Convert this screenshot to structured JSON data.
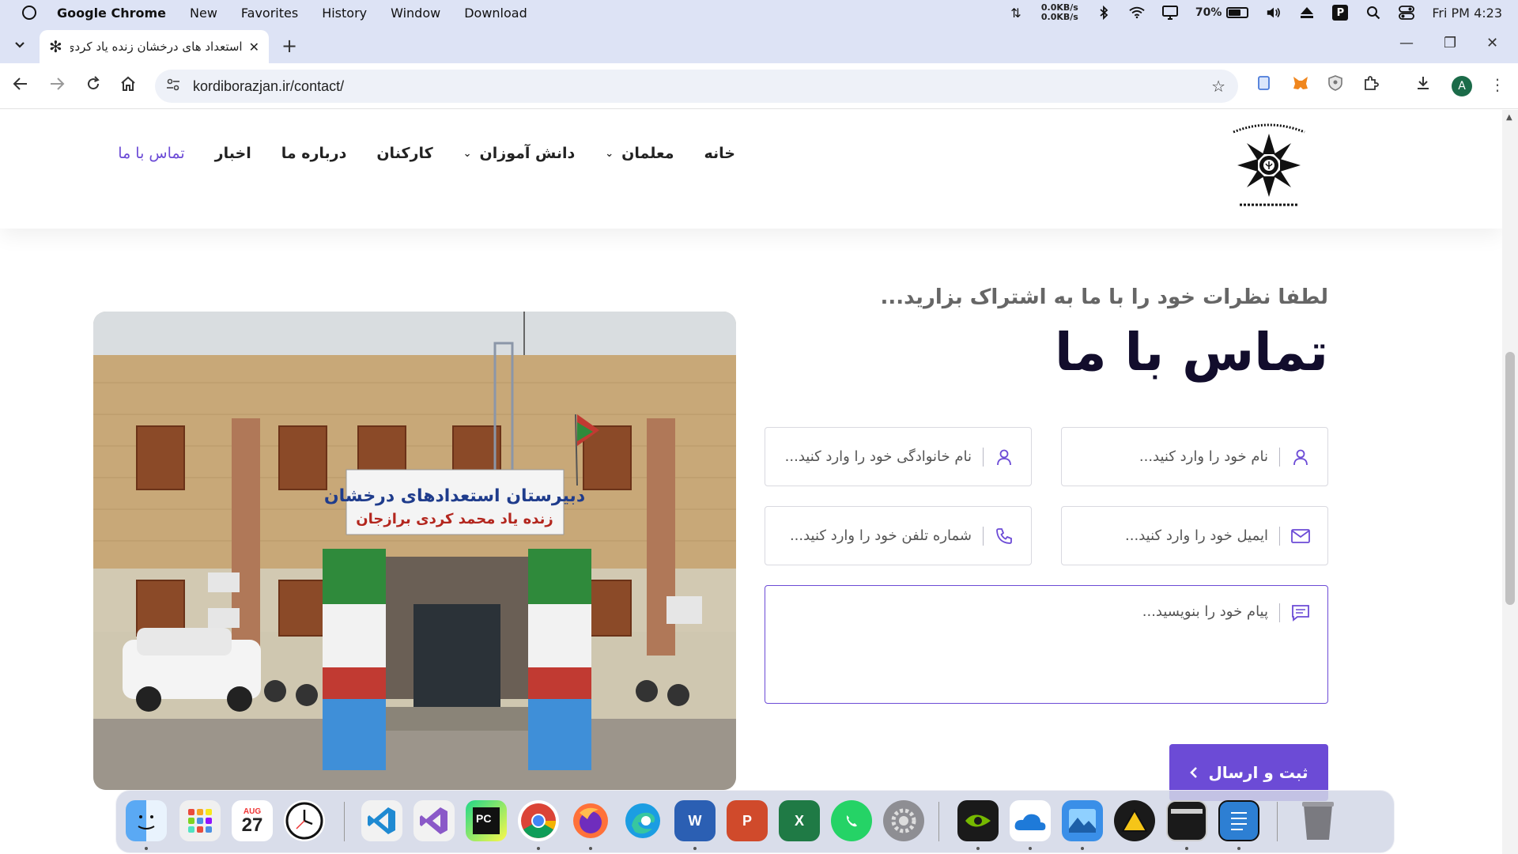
{
  "menubar": {
    "app": "Google Chrome",
    "items": [
      "New",
      "Favorites",
      "History",
      "Window",
      "Download"
    ],
    "net_up": "0.0KB/s",
    "net_down": "0.0KB/s",
    "battery": "70%",
    "battery_level": 0.7,
    "clock": "Fri PM 4:23",
    "p_label": "P"
  },
  "browser": {
    "tab_title": "استعداد های درخشان زنده یاد کردی",
    "url": "kordiborazjan.ir/contact/",
    "avatar": "A"
  },
  "site": {
    "nav": [
      "خانه",
      "معلمان",
      "دانش آموزان",
      "کارکنان",
      "درباره ما",
      "اخبار",
      "تماس با ما"
    ],
    "subtitle": "لطفا نظرات خود را با ما به اشتراک بزارید...",
    "title": "تماس با ما",
    "form": {
      "first_name_placeholder": "نام خود را وارد کنید...",
      "last_name_placeholder": "نام خانوادگی خود را وارد کنید...",
      "email_placeholder": "ایمیل خود را وارد کنید...",
      "phone_placeholder": "شماره تلفن خود را وارد کنید...",
      "message_placeholder": "پیام خود را بنویسید...",
      "submit": "ثبت و ارسال"
    },
    "photo_sign": {
      "line1": "دبیرستان استعدادهای درخشان",
      "line2": "زنده یاد محمد کردی برازجان"
    }
  },
  "dock": {
    "calendar_day": "27",
    "calendar_month": "AUG",
    "word": "W",
    "powerpoint": "P",
    "excel": "X",
    "pycharm": "PC"
  },
  "colors": {
    "accent": "#6c4bd6",
    "headline": "#120d2c",
    "os_bar": "#dde3f5"
  }
}
